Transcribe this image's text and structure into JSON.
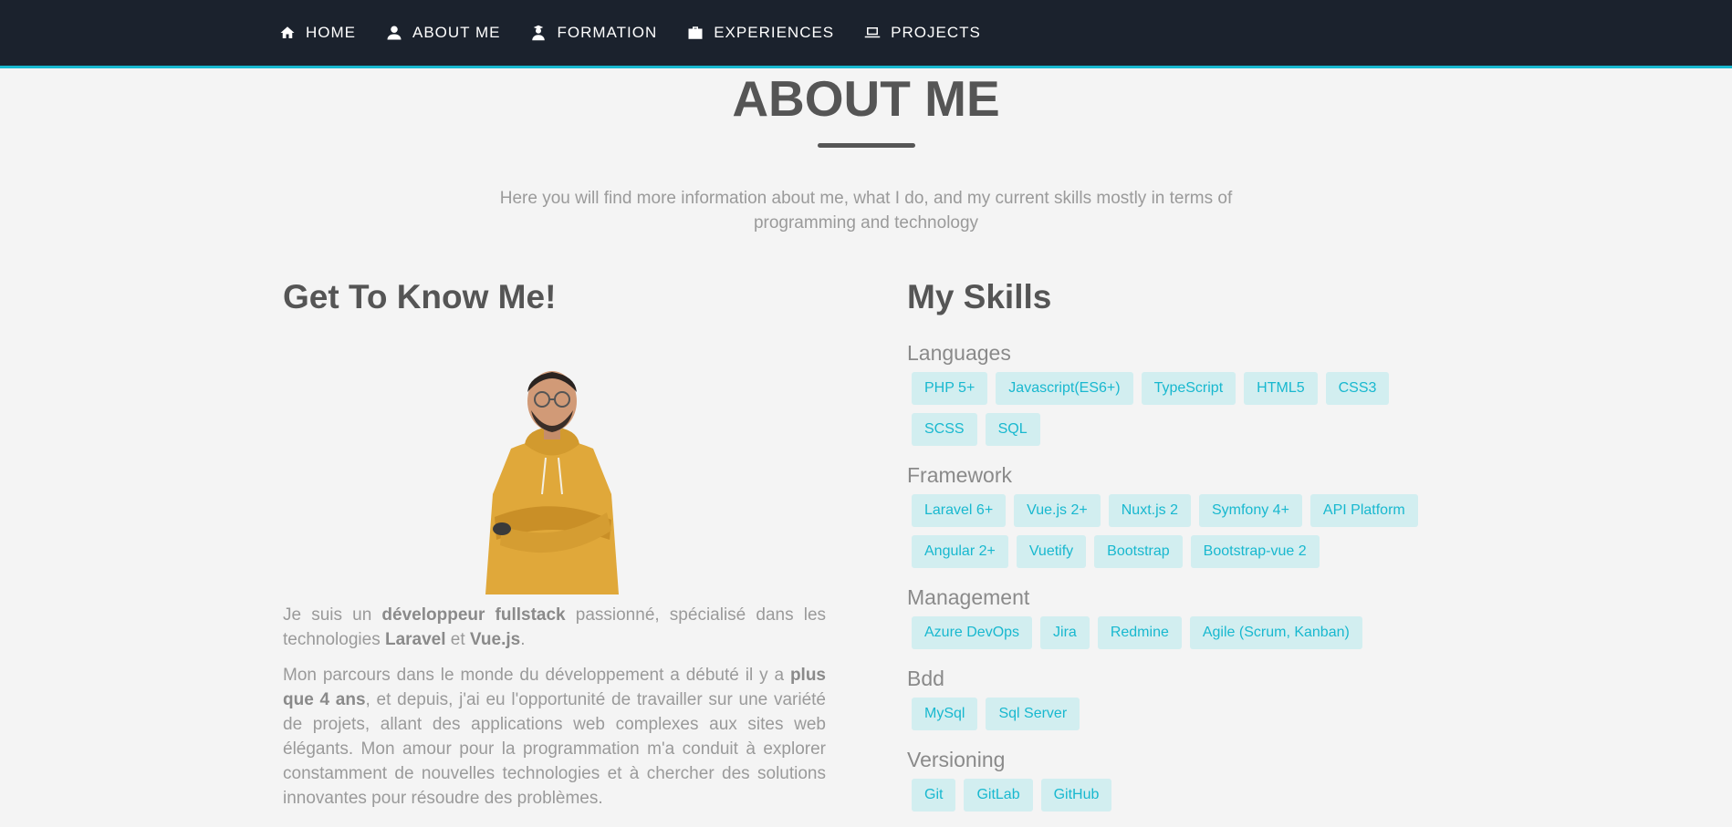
{
  "nav": {
    "items": [
      {
        "label": "HOME",
        "icon": "home-icon"
      },
      {
        "label": "ABOUT ME",
        "icon": "user-icon"
      },
      {
        "label": "FORMATION",
        "icon": "graduate-icon"
      },
      {
        "label": "EXPERIENCES",
        "icon": "briefcase-icon"
      },
      {
        "label": "PROJECTS",
        "icon": "laptop-icon"
      }
    ],
    "accent_color": "#18b8cf",
    "background_color": "#1b222d"
  },
  "header": {
    "title": "ABOUT ME",
    "intro": "Here you will find more information about me, what I do, and my current skills mostly in terms of programming and technology"
  },
  "about": {
    "heading": "Get To Know Me!",
    "bio_p1": {
      "t1": "Je suis un ",
      "b1": "développeur fullstack",
      "t2": " passionné, spécialisé dans les technologies ",
      "b2": "Laravel",
      "t3": " et ",
      "b3": "Vue.js",
      "t4": "."
    },
    "bio_p2": {
      "t1": "Mon parcours dans le monde du développement a débuté il y a ",
      "b1": "plus que 4 ans",
      "t2": ", et depuis, j'ai eu l'opportunité de travailler sur une variété de projets, allant des applications web complexes aux sites web élégants. Mon amour pour la programmation m'a conduit à explorer constamment de nouvelles technologies et à chercher des solutions innovantes pour résoudre des problèmes."
    }
  },
  "skills": {
    "heading": "My Skills",
    "groups": [
      {
        "title": "Languages",
        "tags": [
          "PHP 5+",
          "Javascript(ES6+)",
          "TypeScript",
          "HTML5",
          "CSS3",
          "SCSS",
          "SQL"
        ]
      },
      {
        "title": "Framework",
        "tags": [
          "Laravel 6+",
          "Vue.js 2+",
          "Nuxt.js 2",
          "Symfony 4+",
          "API Platform",
          "Angular 2+",
          "Vuetify",
          "Bootstrap",
          "Bootstrap-vue 2"
        ]
      },
      {
        "title": "Management",
        "tags": [
          "Azure DevOps",
          "Jira",
          "Redmine",
          "Agile (Scrum, Kanban)"
        ]
      },
      {
        "title": "Bdd",
        "tags": [
          "MySql",
          "Sql Server"
        ]
      },
      {
        "title": "Versioning",
        "tags": [
          "Git",
          "GitLab",
          "GitHub"
        ]
      }
    ]
  }
}
